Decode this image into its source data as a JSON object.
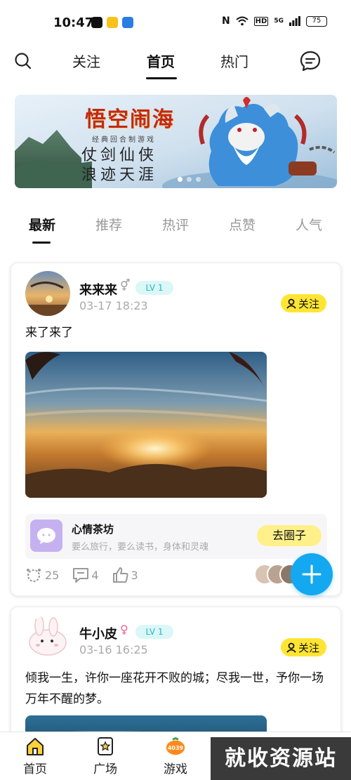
{
  "status_bar": {
    "time": "10:47",
    "battery": "75",
    "network": "5G",
    "hd": "HD"
  },
  "top_nav": {
    "tabs": [
      {
        "label": "关注"
      },
      {
        "label": "首页"
      },
      {
        "label": "热门"
      }
    ],
    "active_tab": "首页"
  },
  "banner": {
    "title": "悟空闹海",
    "subtitle": "经典回合制游戏",
    "line1": "仗剑仙侠",
    "line2": "浪迹天涯"
  },
  "sub_tabs": {
    "items": [
      {
        "label": "最新"
      },
      {
        "label": "推荐"
      },
      {
        "label": "热评"
      },
      {
        "label": "点赞"
      },
      {
        "label": "人气"
      }
    ],
    "active": "最新"
  },
  "posts": [
    {
      "username": "来来来",
      "gender_symbol": "⚥",
      "level": "LV 1",
      "time": "03-17 18:23",
      "follow_label": "关注",
      "text": "来了来了",
      "circle": {
        "name": "心情茶坊",
        "desc": "要么旅行，要么读书，身体和灵魂",
        "button": "去圈子"
      },
      "stats": {
        "views": "25",
        "comments": "4",
        "likes": "3"
      }
    },
    {
      "username": "牛小皮",
      "gender_symbol": "♀",
      "level": "LV 1",
      "time": "03-16 16:25",
      "follow_label": "关注",
      "text": "倾我一生，许你一座花开不败的城；尽我一世，予你一场万年不醒的梦。"
    }
  ],
  "bottom_nav": {
    "items": [
      {
        "label": "首页"
      },
      {
        "label": "广场"
      },
      {
        "label": "游戏"
      }
    ],
    "game_badge": "4039"
  },
  "watermark": "就收资源站",
  "colors": {
    "accent_yellow": "#ffe533",
    "fab_blue": "#14a8f0",
    "level_teal": "#27b6c4"
  }
}
